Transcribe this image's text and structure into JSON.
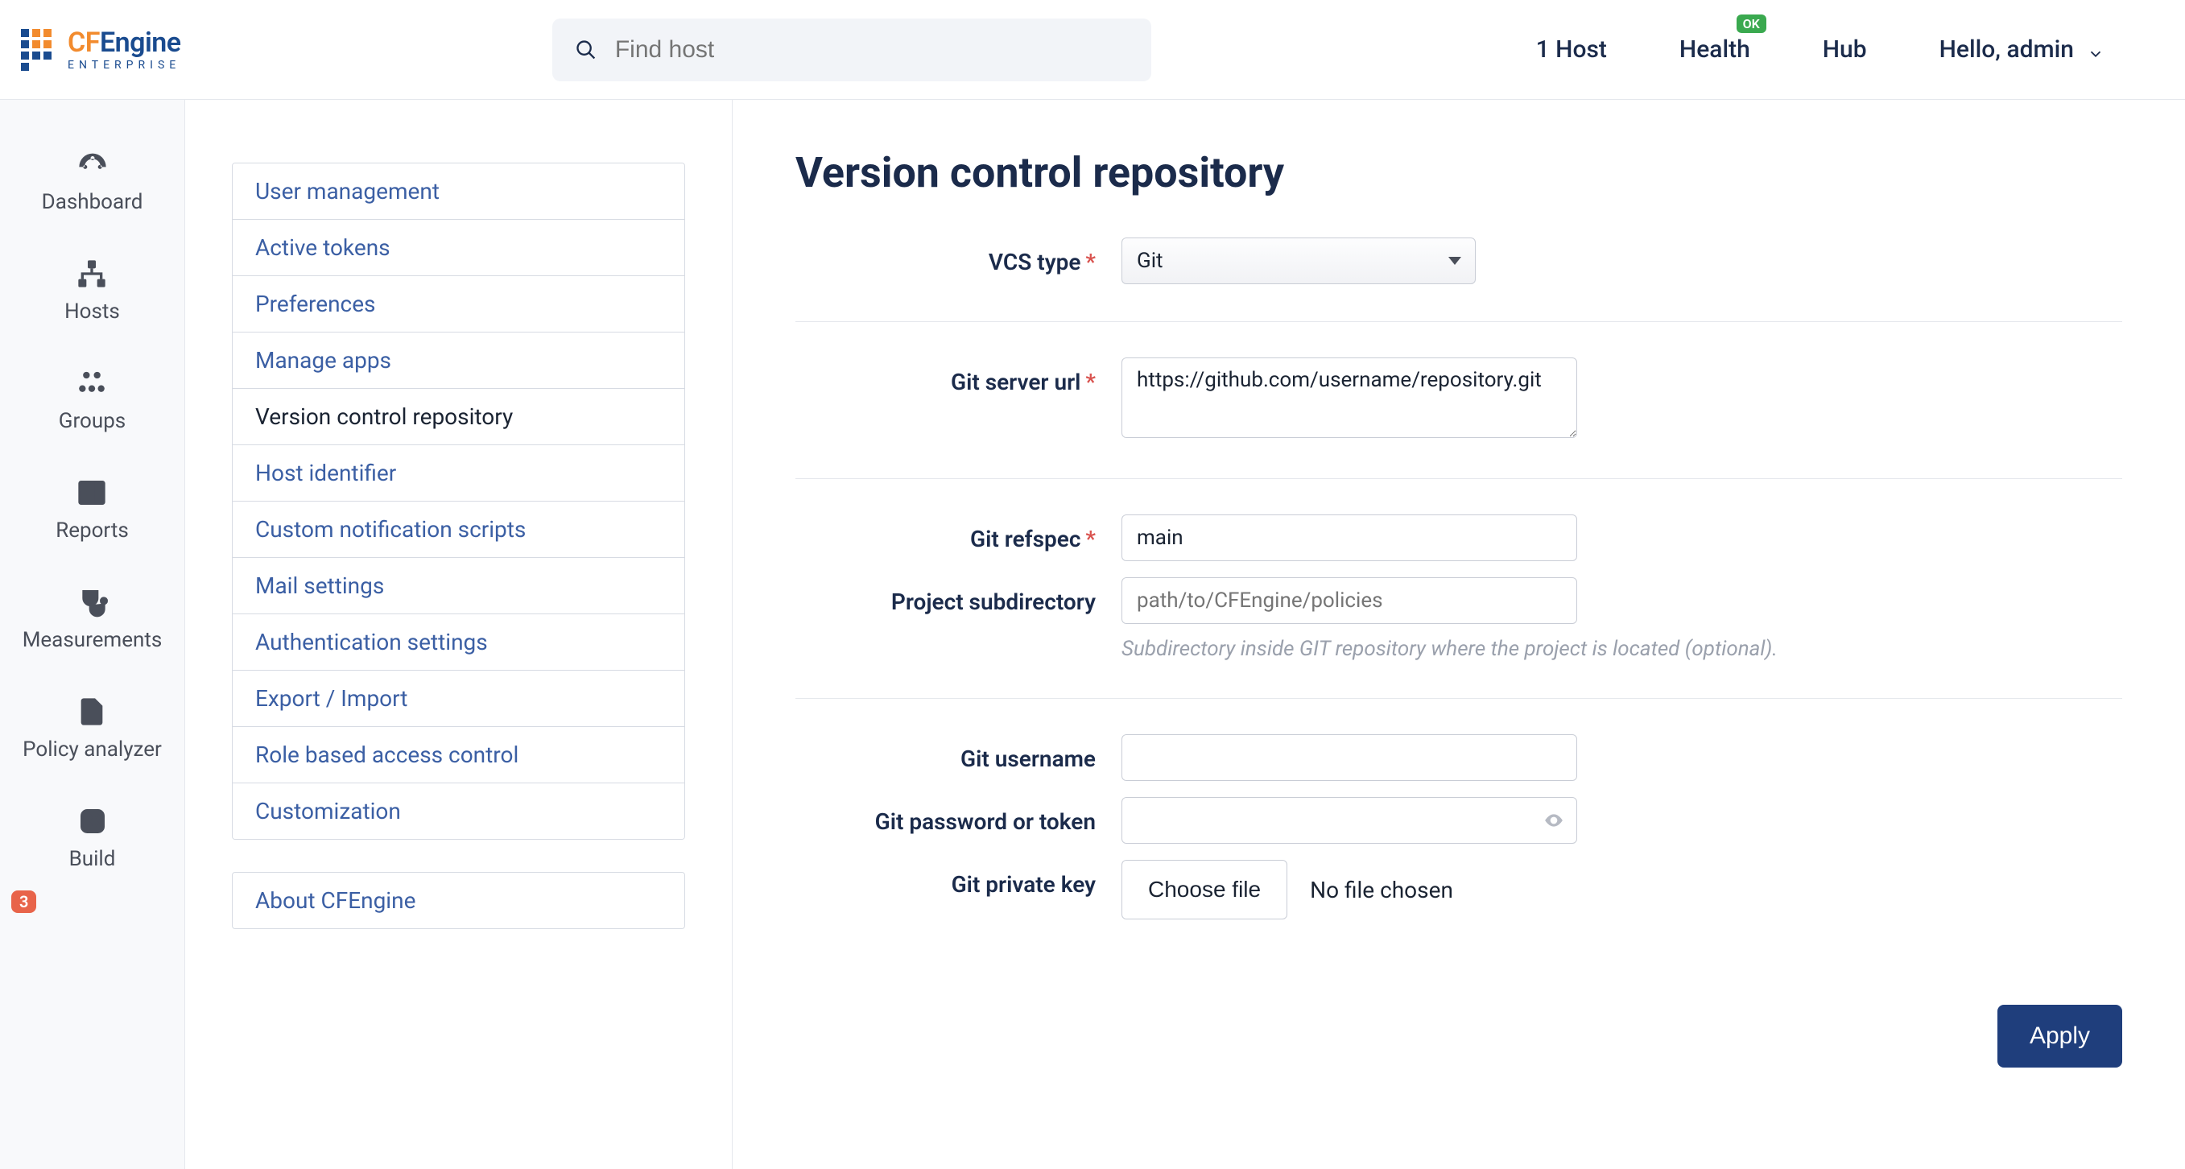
{
  "header": {
    "logo_main_cf": "CF",
    "logo_main_eng": "Engine",
    "logo_sub": "ENTERPRISE",
    "search_placeholder": "Find host",
    "hosts_link": "1 Host",
    "health_link": "Health",
    "health_badge": "OK",
    "hub_link": "Hub",
    "hello": "Hello, admin"
  },
  "nav": {
    "dashboard": "Dashboard",
    "hosts": "Hosts",
    "groups": "Groups",
    "reports": "Reports",
    "measurements": "Measurements",
    "policy_analyzer": "Policy analyzer",
    "policy_badge": "3",
    "build": "Build"
  },
  "settings_menu": {
    "items": [
      "User management",
      "Active tokens",
      "Preferences",
      "Manage apps",
      "Version control repository",
      "Host identifier",
      "Custom notification scripts",
      "Mail settings",
      "Authentication settings",
      "Export / Import",
      "Role based access control",
      "Customization"
    ],
    "active_index": 4,
    "about": "About CFEngine"
  },
  "page": {
    "title": "Version control repository",
    "vcs_type_label": "VCS type",
    "vcs_type_value": "Git",
    "git_url_label": "Git server url",
    "git_url_value": "https://github.com/username/repository.git",
    "git_refspec_label": "Git refspec",
    "git_refspec_value": "main",
    "subdir_label": "Project subdirectory",
    "subdir_placeholder": "path/to/CFEngine/policies",
    "subdir_help": "Subdirectory inside GIT repository where the project is located (optional).",
    "git_user_label": "Git username",
    "git_pw_label": "Git password or token",
    "git_key_label": "Git private key",
    "choose_file": "Choose file",
    "no_file": "No file chosen",
    "apply": "Apply"
  }
}
